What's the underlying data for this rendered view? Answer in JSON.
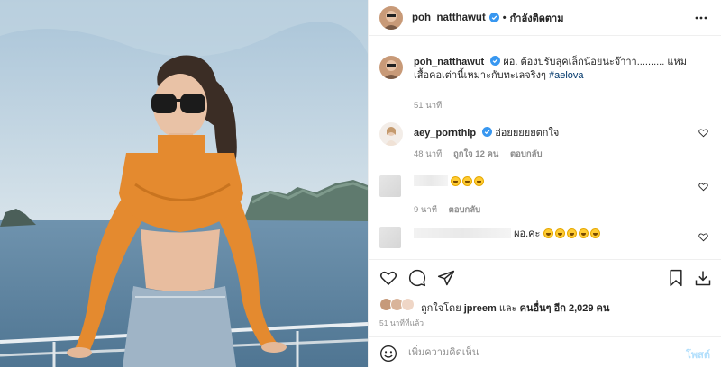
{
  "post": {
    "author": "poh_natthawut",
    "follow_label": "กำลังติดตาม",
    "dot": "•"
  },
  "caption": {
    "author": "poh_natthawut",
    "text": "ผอ. ต้องปรับลุคเล็กน้อยนะจ๊าาา.......... แหม เสื้อคอเต่านี้เหมาะกับทะเลจริงๆ",
    "hashtag": "#aelova",
    "time": "51 นาที"
  },
  "comments": [
    {
      "author": "aey_pornthip",
      "text": "อ่อยยยยยตกใจ",
      "time": "48 นาที",
      "likes": "ถูกใจ 12 คน",
      "reply": "ตอบกลับ"
    },
    {
      "author": "",
      "text": "",
      "time": "9 นาที",
      "reply": "ตอบกลับ"
    },
    {
      "author": "",
      "text": "ผอ.คะ",
      "time": "",
      "reply": ""
    }
  ],
  "likes_line": {
    "prefix": "ถูกใจโดย",
    "user": "jpreem",
    "middle": "และ",
    "others": "คนอื่นๆ อีก 2,029 คน"
  },
  "time_ago": "51 นาทีที่แล้ว",
  "add_comment": {
    "placeholder": "เพิ่มความคิดเห็น",
    "post_label": "โพสต์"
  },
  "colors": {
    "link": "#00376b",
    "verified": "#3897f0",
    "post_disabled": "#b2dffc",
    "meta_gray": "#8e8e8e",
    "shirt_orange": "#e48a2f"
  },
  "icons": [
    "more-options-icon",
    "heart-icon",
    "comment-icon",
    "share-icon",
    "bookmark-icon",
    "download-icon",
    "emoji-icon",
    "verified-badge-icon"
  ]
}
